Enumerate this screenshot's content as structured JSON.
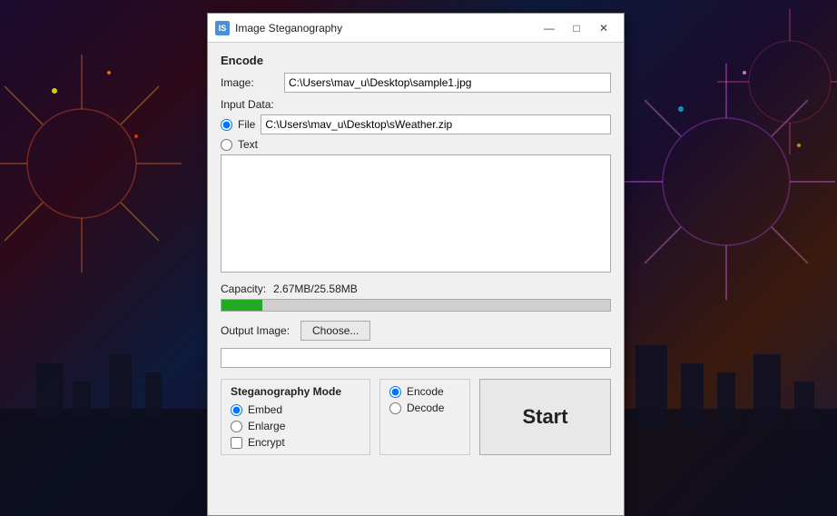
{
  "background": {
    "description": "Fireworks night cityscape"
  },
  "window": {
    "title": "Image Steganography",
    "icon_label": "IS",
    "minimize_label": "—",
    "maximize_label": "□",
    "close_label": "✕"
  },
  "encode_section": {
    "label": "Encode",
    "image_label": "Image:",
    "image_value": "C:\\Users\\mav_u\\Desktop\\sample1.jpg"
  },
  "input_data": {
    "label": "Input Data:",
    "file_radio_label": "File",
    "text_radio_label": "Text",
    "file_value": "C:\\Users\\mav_u\\Desktop\\sWeather.zip",
    "text_value": "",
    "file_selected": true
  },
  "capacity": {
    "label": "Capacity:",
    "value": "2.67MB/25.58MB",
    "fill_percent": 10.4
  },
  "output_image": {
    "label": "Output Image:",
    "choose_label": "Choose...",
    "path_value": ""
  },
  "steganography_mode": {
    "title": "Steganography Mode",
    "embed_label": "Embed",
    "enlarge_label": "Enlarge",
    "encrypt_label": "Encrypt",
    "embed_selected": true,
    "enlarge_selected": false,
    "encrypt_checked": false
  },
  "encode_decode": {
    "encode_label": "Encode",
    "decode_label": "Decode",
    "encode_selected": true
  },
  "start_button": {
    "label": "Start"
  }
}
